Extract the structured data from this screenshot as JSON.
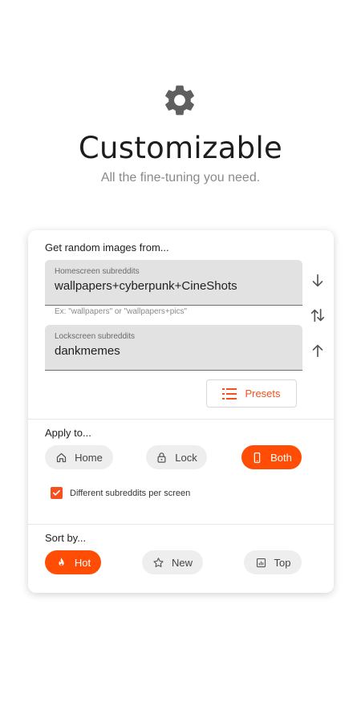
{
  "hero": {
    "icon": "gear-icon",
    "title": "Customizable",
    "subtitle": "All the fine-tuning you need."
  },
  "card": {
    "source_label": "Get random images from...",
    "home_field": {
      "label": "Homescreen subreddits",
      "value": "wallpapers+cyberpunk+CineShots"
    },
    "helper": "Ex: \"wallpapers\" or \"wallpapers+pics\"",
    "lock_field": {
      "label": "Lockscreen subreddits",
      "value": "dankmemes"
    },
    "side_icons": [
      "arrow-down-icon",
      "swap-icon",
      "arrow-up-icon"
    ],
    "presets_label": "Presets",
    "apply_label": "Apply to...",
    "apply_options": [
      {
        "label": "Home",
        "icon": "home-icon",
        "selected": false
      },
      {
        "label": "Lock",
        "icon": "lock-icon",
        "selected": false
      },
      {
        "label": "Both",
        "icon": "phone-icon",
        "selected": true
      }
    ],
    "different_label": "Different subreddits per screen",
    "different_checked": true,
    "sort_label": "Sort by...",
    "sort_options": [
      {
        "label": "Hot",
        "icon": "flame-icon",
        "selected": true
      },
      {
        "label": "New",
        "icon": "star-icon",
        "selected": false
      },
      {
        "label": "Top",
        "icon": "chart-icon",
        "selected": false
      }
    ]
  },
  "colors": {
    "accent": "#ff4d06",
    "field_bg": "#e2e2e2",
    "gear": "#5f5f5f"
  }
}
